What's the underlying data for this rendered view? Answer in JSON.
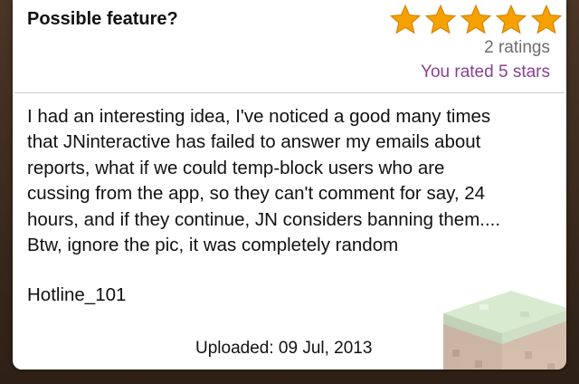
{
  "post": {
    "title": "Possible feature?",
    "stars": {
      "count": 5,
      "filled": 5,
      "icon": "star-icon",
      "color": "#f5a100"
    },
    "ratings_count": "2 ratings",
    "user_rating": "You rated 5 stars",
    "body": "I had an interesting idea, I've noticed a good many times\nthat JNinteractive has failed to answer my emails about\nreports, what if we could temp-block users who are\ncussing from the app, so they can't comment for say, 24\nhours, and if they continue, JN considers banning them....\nBtw, ignore the pic, it was completely random",
    "author": "Hotline_101",
    "uploaded": "Uploaded: 09 Jul, 2013",
    "thumbnail_icon": "grass-block-icon"
  },
  "colors": {
    "user_rating_text": "#8b3f93",
    "ratings_text": "#6e6e6e",
    "frame": "#3b2a1c"
  }
}
